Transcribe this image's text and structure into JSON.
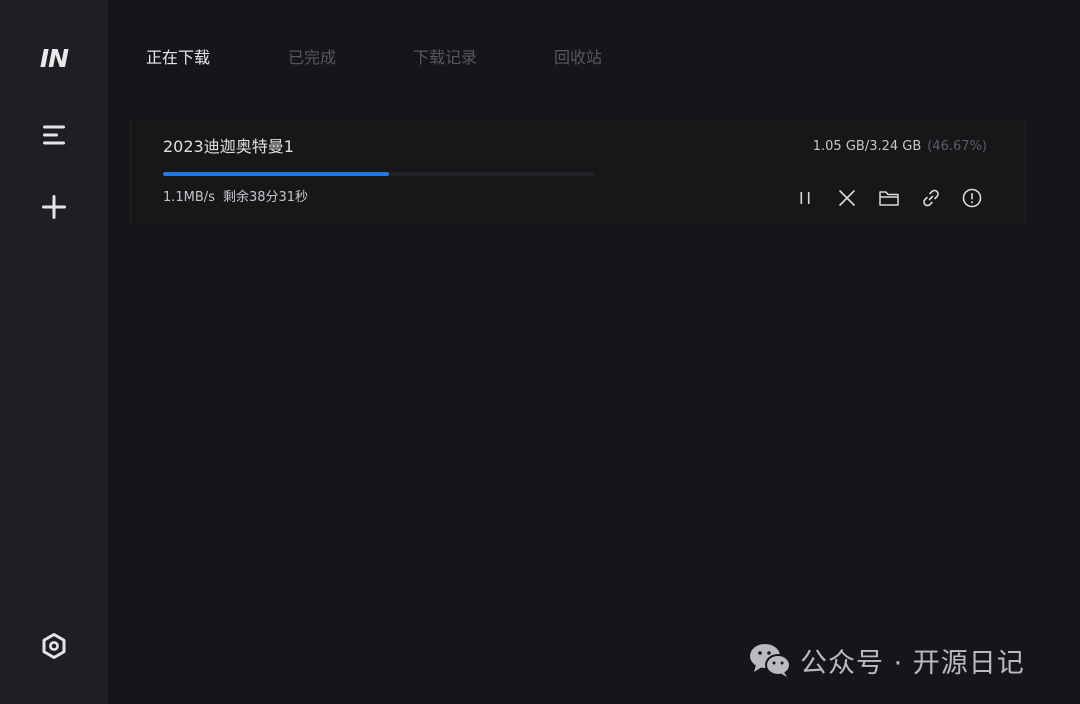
{
  "sidebar": {
    "logo_text": "IN",
    "items": [
      {
        "name": "menu-icon"
      },
      {
        "name": "add-icon"
      },
      {
        "name": "settings-icon"
      }
    ]
  },
  "tabs": [
    {
      "label": "正在下载",
      "active": true
    },
    {
      "label": "已完成",
      "active": false
    },
    {
      "label": "下载记录",
      "active": false
    },
    {
      "label": "回收站",
      "active": false
    }
  ],
  "downloads": [
    {
      "title": "2023迪迦奥特曼1",
      "size": "1.05 GB/3.24 GB",
      "percent": "(46.67%)",
      "progress": 0.5243,
      "speed": "1.1MB/s",
      "remaining": "剩余38分31秒",
      "actions": [
        "pause-icon",
        "close-icon",
        "folder-icon",
        "link-icon",
        "info-icon"
      ]
    }
  ],
  "watermark": {
    "text": "公众号 · 开源日记",
    "icon": "wechat-icon"
  },
  "colors": {
    "accent": "#1e7ae8",
    "background": "#151619",
    "sidebar": "#1e1f22"
  }
}
